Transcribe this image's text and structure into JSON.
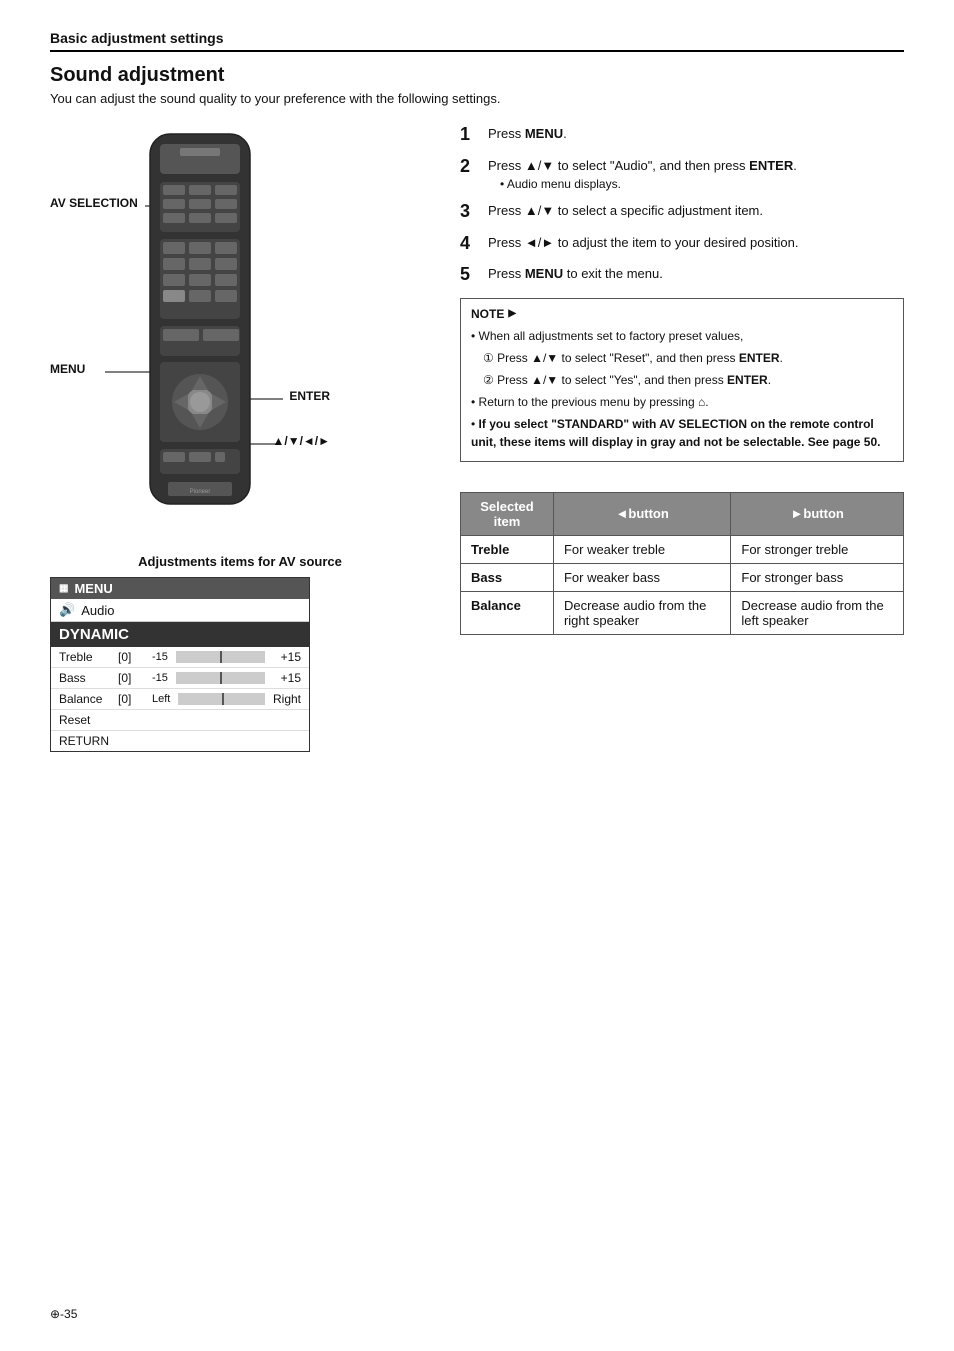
{
  "header": {
    "section": "Basic adjustment settings",
    "title": "Sound adjustment",
    "subtitle": "You can adjust the sound quality to your preference with the following settings."
  },
  "remote": {
    "labels": {
      "av_selection": "AV SELECTION",
      "menu": "MENU",
      "enter": "ENTER",
      "arrows": "▲/▼/◄/►"
    }
  },
  "steps": [
    {
      "num": "1",
      "text": "Press ",
      "bold": "MENU",
      "after": "."
    },
    {
      "num": "2",
      "text": "Press ▲/▼ to select \"Audio\", and then press ",
      "bold": "ENTER",
      "after": ".",
      "subitem": "• Audio menu displays."
    },
    {
      "num": "3",
      "text": "Press ▲/▼ to select a specific adjustment item."
    },
    {
      "num": "4",
      "text": "Press ◄/► to adjust the item to your desired position."
    },
    {
      "num": "5",
      "text": "Press ",
      "bold": "MENU",
      "after": " to exit the menu."
    }
  ],
  "note": {
    "header": "NOTE",
    "items": [
      "When all adjustments set to factory preset values,",
      "① Press ▲/▼ to select \"Reset\", and then press ENTER.",
      "② Press ▲/▼ to select \"Yes\", and then press ENTER.",
      "• Return to the previous menu by pressing 🏠.",
      "• If you select \"STANDARD\" with AV SELECTION on the remote control unit, these items will display in gray and not be selectable. See page 50."
    ]
  },
  "menu_box": {
    "header": "MENU",
    "audio_label": "Audio",
    "dynamic_label": "DYNAMIC",
    "rows": [
      {
        "label": "Treble",
        "value": "[0]",
        "range_min": "-15",
        "range_max": "+15"
      },
      {
        "label": "Bass",
        "value": "[0]",
        "range_min": "-15",
        "range_max": "+15"
      },
      {
        "label": "Balance",
        "value": "[0]",
        "range_extra": "Left",
        "range_max": "Right"
      }
    ],
    "reset": "Reset",
    "return": "RETURN"
  },
  "adj_section": {
    "title": "Adjustments items for AV source"
  },
  "table": {
    "headers": [
      "Selected item",
      "◄button",
      "►button"
    ],
    "rows": [
      {
        "item": "Treble",
        "left": "For weaker treble",
        "right": "For stronger treble"
      },
      {
        "item": "Bass",
        "left": "For weaker bass",
        "right": "For stronger bass"
      },
      {
        "item": "Balance",
        "left": "Decrease audio from the right speaker",
        "right": "Decrease audio from the left speaker"
      }
    ]
  },
  "footer": {
    "text": "⊕-35"
  }
}
